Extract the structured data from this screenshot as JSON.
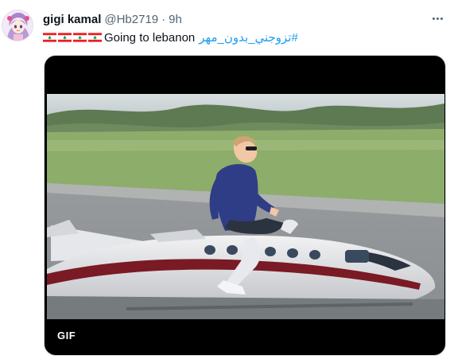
{
  "tweet": {
    "author_name": "gigi kamal",
    "handle": "@Hb2719",
    "separator": "·",
    "time": "9h",
    "text": "Going to lebanon",
    "hashtag": "#تزوجني_بدون_مهر",
    "flag_icons": [
      "lebanon-flag-icon",
      "lebanon-flag-icon",
      "lebanon-flag-icon",
      "lebanon-flag-icon"
    ]
  },
  "media": {
    "badge": "GIF"
  },
  "colors": {
    "accent": "#1d9bf0",
    "text_primary": "#0f1419",
    "text_secondary": "#536471",
    "lebanon_red": "#ee1c24",
    "cedar_green": "#00a651"
  },
  "icons": {
    "more": "more-horizontal-icon",
    "avatar": "anime-avatar"
  }
}
